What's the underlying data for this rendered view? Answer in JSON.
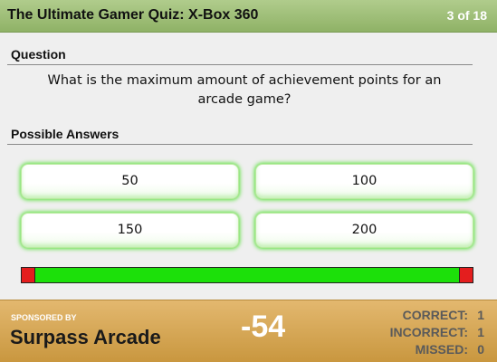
{
  "header": {
    "title": "The Ultimate Gamer Quiz: X-Box 360",
    "progress": "3 of 18"
  },
  "question_section": {
    "label": "Question",
    "text": "What is the maximum amount of achievement points for an arcade game?"
  },
  "answers_section": {
    "label": "Possible Answers",
    "answers": [
      "50",
      "100",
      "150",
      "200"
    ]
  },
  "timer": {
    "remaining_fraction": 0.96
  },
  "footer": {
    "sponsored_by": "SPONSORED BY",
    "sponsor": "Surpass Arcade",
    "score": "-54",
    "stats": {
      "correct_label": "CORRECT:",
      "correct": "1",
      "incorrect_label": "INCORRECT:",
      "incorrect": "1",
      "missed_label": "MISSED:",
      "missed": "0"
    }
  },
  "colors": {
    "header": "#9dbd78",
    "footer": "#d6a954",
    "timer_fill": "#1ce00a",
    "timer_empty": "#e41e1e",
    "answer_glow": "#58e13a"
  }
}
